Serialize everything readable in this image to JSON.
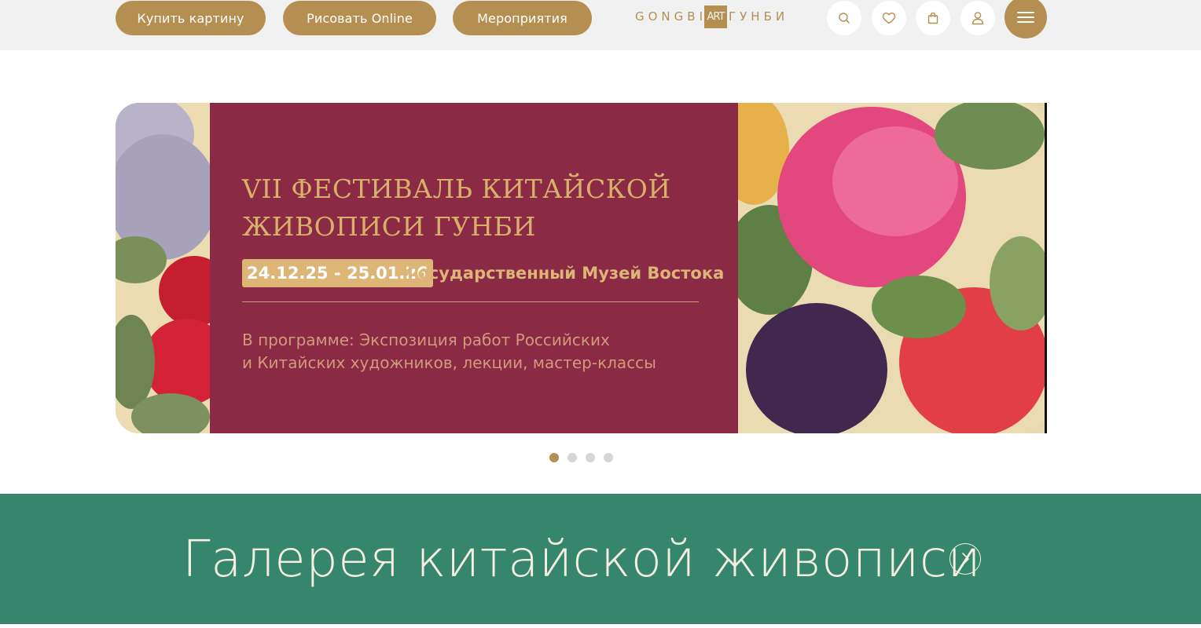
{
  "header": {
    "nav": {
      "buy_label": "Купить картину",
      "draw_label": "Рисовать Online",
      "events_label": "Мероприятия"
    },
    "logo": {
      "left": "GONGBI",
      "box": "ART",
      "right": "ГУНБИ"
    },
    "icons": {
      "search": "search-icon",
      "favorites": "heart-icon",
      "cart": "bag-icon",
      "account": "user-icon",
      "menu": "hamburger-icon"
    }
  },
  "banner": {
    "title_line1": "VII ФЕСТИВАЛЬ КИТАЙСКОЙ",
    "title_line2": "ЖИВОПИСИ ГУНБИ",
    "dates": "24.12.25 - 25.01.26",
    "place": "Государственный Музей Востока",
    "desc_line1": "В программе: Экспозиция работ Российских",
    "desc_line2": "и Китайских художников, лекции, мастер-классы"
  },
  "carousel": {
    "slides": 4,
    "active": 1
  },
  "gallery": {
    "title": "Галерея китайской живописи",
    "arrow_icon": "chevron-right-icon"
  },
  "colors": {
    "accent": "#b48f51",
    "banner_bg": "#8a2a45",
    "gallery_bg": "#36856d",
    "header_bg": "#f1f1f1"
  }
}
